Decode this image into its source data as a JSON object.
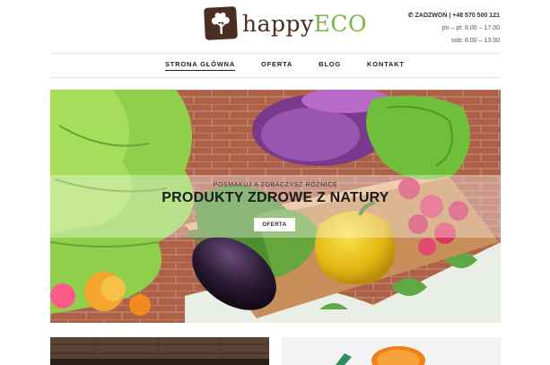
{
  "header": {
    "logo_text_happy": "happy",
    "logo_text_eco": "ECO",
    "logo_icon": "tree-icon",
    "contact": {
      "phone_icon": "phone-icon",
      "phone_line": "ZADZWOŃ | +48 570 500 121",
      "hours_weekdays": "pn – pt: 8.00 – 17.00",
      "hours_saturday": "sob: 8.00 – 13.00"
    }
  },
  "nav": {
    "items": [
      {
        "label": "STRONA GŁÓWNA"
      },
      {
        "label": "OFERTA"
      },
      {
        "label": "BLOG"
      },
      {
        "label": "KONTAKT"
      }
    ]
  },
  "hero": {
    "tagline": "POSMAKUJ A ZOBACZYSZ RÓŻNICĘ",
    "title": "PRODUKTY ZDROWE Z NATURY",
    "cta_label": "OFERTA"
  },
  "colors": {
    "brand_brown": "#4a2e22",
    "brand_green": "#7ab648"
  }
}
